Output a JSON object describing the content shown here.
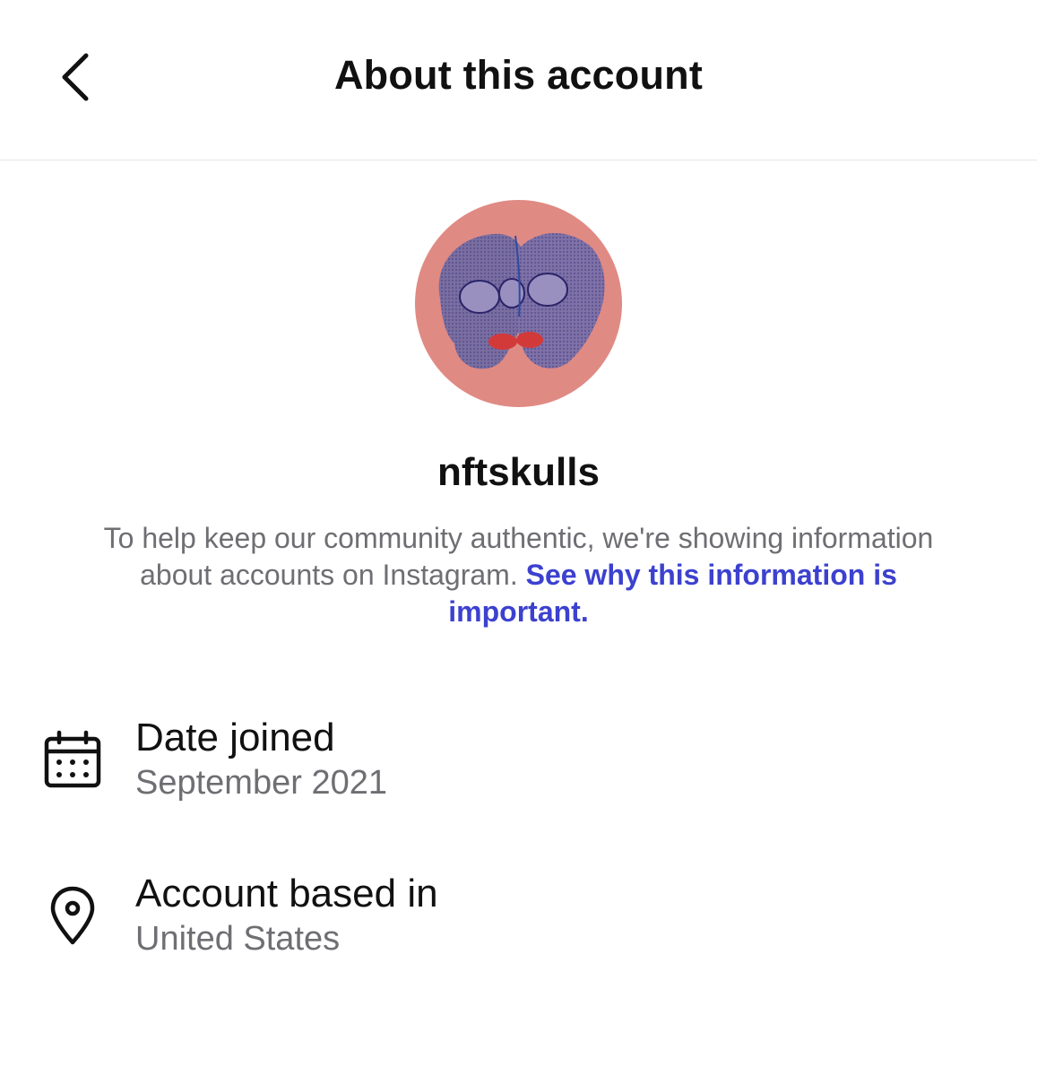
{
  "header": {
    "title": "About this account",
    "back_icon": "chevron-left-icon"
  },
  "profile": {
    "username": "nftskulls",
    "avatar_background": "#e08a84"
  },
  "notice": {
    "text": "To help keep our community authentic, we're showing information about accounts on Instagram. ",
    "link_text": "See why this information is important.",
    "link_color": "#3c41cf"
  },
  "details": [
    {
      "icon": "calendar-icon",
      "label": "Date joined",
      "value": "September 2021"
    },
    {
      "icon": "location-pin-icon",
      "label": "Account based in",
      "value": "United States"
    }
  ]
}
